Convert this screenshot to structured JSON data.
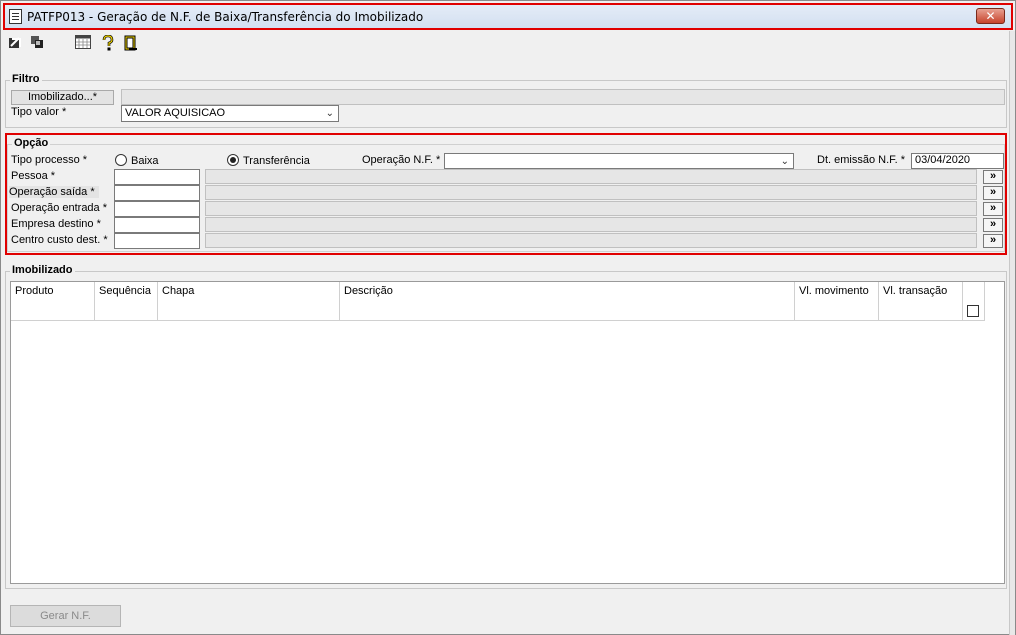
{
  "window": {
    "title": "PATFP013 - Geração de N.F. de Baixa/Transferência do Imobilizado",
    "close_label": "✕"
  },
  "toolbar": {
    "icons": [
      "export-icon",
      "copy-icon",
      "calendar-grid-icon",
      "help-icon",
      "exit-door-icon"
    ]
  },
  "filtro": {
    "title": "Filtro",
    "imobilizado_button": "Imobilizado...*",
    "imobilizado_value": "",
    "tipo_valor_label": "Tipo valor *",
    "tipo_valor_selected": "VALOR AQUISICAO"
  },
  "opcao": {
    "title": "Opção",
    "tipo_processo_label": "Tipo processo *",
    "radio_baixa": "Baixa",
    "radio_transferencia": "Transferência",
    "selected_process": "Transferência",
    "operacao_nf_label": "Operação N.F. *",
    "operacao_nf_value": "",
    "dt_emissao_label": "Dt. emissão N.F. *",
    "dt_emissao_value": "03/04/2020",
    "rows": [
      {
        "label": "Pessoa *",
        "code": "",
        "description": ""
      },
      {
        "label": "Operação saída *",
        "code": "",
        "description": ""
      },
      {
        "label": "Operação entrada *",
        "code": "",
        "description": ""
      },
      {
        "label": "Empresa destino *",
        "code": "",
        "description": ""
      },
      {
        "label": "Centro custo dest. *",
        "code": "",
        "description": ""
      }
    ],
    "lookup_label": "»"
  },
  "imobilizado": {
    "title": "Imobilizado",
    "columns": [
      "Produto",
      "Sequência",
      "Chapa",
      "Descrição",
      "Vl. movimento",
      "Vl. transação"
    ],
    "rows": []
  },
  "footer": {
    "gerar_nf_label": "Gerar N.F."
  },
  "colors": {
    "highlight": "#e00000",
    "window_bg": "#f0f0f0"
  }
}
